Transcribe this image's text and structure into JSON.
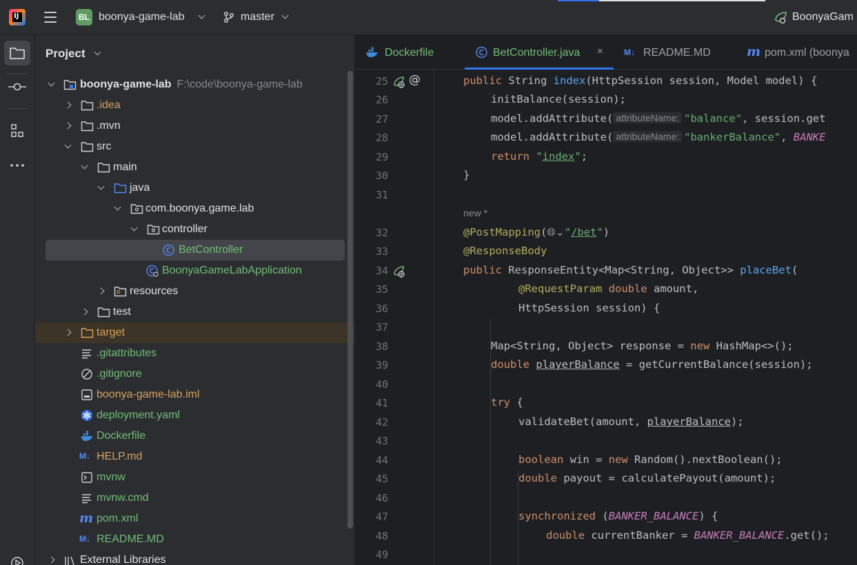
{
  "titlebar": {
    "app_logo_text": "IJ",
    "project_badge": "BL",
    "project_name": "boonya-game-lab",
    "branch": "master",
    "run_config": "BoonyaGam",
    "icons": [
      "main-menu-icon",
      "branch-icon",
      "chevron-down-icon",
      "run-config-icon"
    ]
  },
  "toolstrip": {
    "items": [
      "folder-icon",
      "commit-icon",
      "structure-icon",
      "more-icon"
    ]
  },
  "project_panel": {
    "title": "Project",
    "root": {
      "label": "boonya-game-lab",
      "path": "F:\\code\\boonya-game-lab"
    },
    "items": [
      {
        "label": ".idea"
      },
      {
        "label": ".mvn"
      },
      {
        "label": "src"
      },
      {
        "label": "main"
      },
      {
        "label": "java"
      },
      {
        "label": "com.boonya.game.lab"
      },
      {
        "label": "controller"
      },
      {
        "label": "BetController"
      },
      {
        "label": "BoonyaGameLabApplication"
      },
      {
        "label": "resources"
      },
      {
        "label": "test"
      },
      {
        "label": "target"
      },
      {
        "label": ".gitattributes"
      },
      {
        "label": ".gitignore"
      },
      {
        "label": "boonya-game-lab.iml"
      },
      {
        "label": "deployment.yaml"
      },
      {
        "label": "Dockerfile"
      },
      {
        "label": "HELP.md"
      },
      {
        "label": "mvnw"
      },
      {
        "label": "mvnw.cmd"
      },
      {
        "label": "pom.xml"
      },
      {
        "label": "README.MD"
      },
      {
        "label": "External Libraries"
      }
    ]
  },
  "editor": {
    "tabs": [
      {
        "label": "Dockerfile"
      },
      {
        "label": "BetController.java",
        "close": "×"
      },
      {
        "label": "README.MD"
      },
      {
        "label": "pom.xml (boonya"
      }
    ],
    "line_numbers": [
      "25",
      "26",
      "27",
      "28",
      "29",
      "30",
      "31",
      "32",
      "33",
      "34",
      "35",
      "36",
      "37",
      "38",
      "39",
      "40",
      "41",
      "42",
      "43",
      "44",
      "45",
      "46",
      "47",
      "48",
      "49"
    ],
    "author_hint": "new *",
    "inlay_hint": "attributeName:",
    "code": {
      "l25_a": "public ",
      "l25_b": "String ",
      "l25_c": "index",
      "l25_d": "(HttpSession session, Model model) {",
      "l26": "initBalance(session);",
      "l27_a": "model.addAttribute(",
      "l27_b": "\"balance\"",
      "l27_c": ", session.get",
      "l28_a": "model.addAttribute(",
      "l28_b": "\"bankerBalance\"",
      "l28_c": ", ",
      "l28_d": "BANKE",
      "l29_a": "return ",
      "l29_b": "\"",
      "l29_c": "index",
      "l29_d": "\"",
      "l29_e": ";",
      "l30": "}",
      "l32_a": "@PostMapping",
      "l32_b": "(",
      "l32_c": "\"",
      "l32_d": "/bet",
      "l32_e": "\"",
      "l32_f": ")",
      "l33": "@ResponseBody",
      "l34_a": "public ",
      "l34_b": "ResponseEntity<Map<String, Object>> ",
      "l34_c": "placeBet",
      "l34_d": "(",
      "l35_a": "@RequestParam ",
      "l35_b": "double ",
      "l35_c": "amount,",
      "l36": "HttpSession session) {",
      "l38_a": "Map<String, Object> response = ",
      "l38_b": "new ",
      "l38_c": "HashMap<>();",
      "l39_a": "double ",
      "l39_b": "playerBalance",
      "l39_c": " = getCurrentBalance(session);",
      "l41_a": "try ",
      "l41_b": "{",
      "l42_a": "validateBet(amount, ",
      "l42_b": "playerBalance",
      "l42_c": ");",
      "l44_a": "boolean ",
      "l44_b": "win = ",
      "l44_c": "new ",
      "l44_d": "Random().nextBoolean();",
      "l45_a": "double ",
      "l45_b": "payout = calculatePayout(amount);",
      "l47_a": "synchronized ",
      "l47_b": "(",
      "l47_c": "BANKER_BALANCE",
      "l47_d": ") {",
      "l48_a": "double ",
      "l48_b": "currentBanker = ",
      "l48_c": "BANKER_BALANCE",
      "l48_d": ".get();"
    }
  },
  "colors": {
    "accent": "#3574f0",
    "keyword": "#cf8e6d",
    "string": "#6aab73",
    "function": "#56a8f5",
    "annotation": "#b3ae60",
    "constant": "#c77dbb",
    "tree_orange": "#d9a25e",
    "tree_green": "#73bd79"
  }
}
